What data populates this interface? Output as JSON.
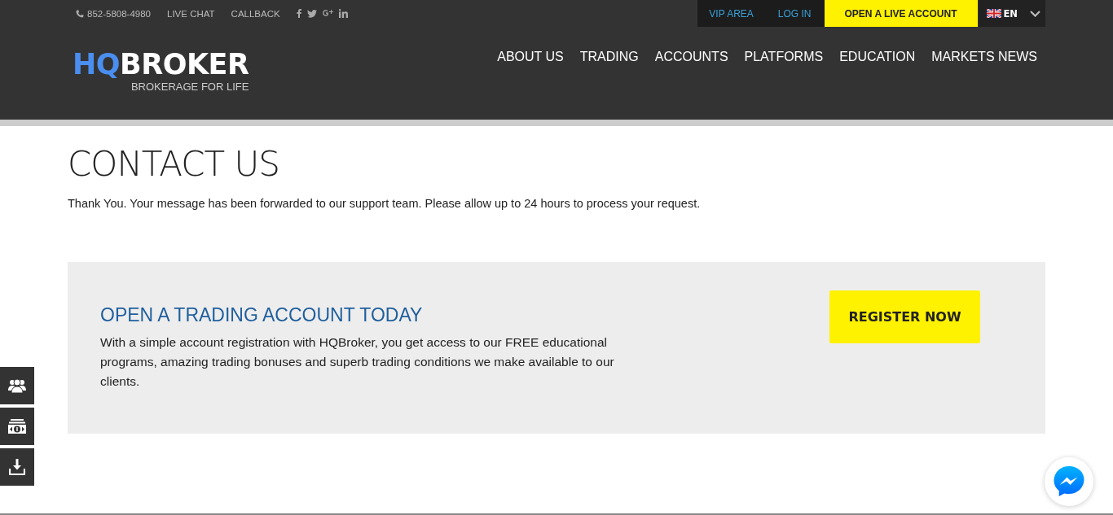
{
  "topbar": {
    "phone": "852-5808-4980",
    "links": [
      "LIVE CHAT",
      "CALLBACK"
    ],
    "social": [
      {
        "kind": "facebook"
      },
      {
        "kind": "twitter"
      },
      {
        "kind": "google-plus"
      },
      {
        "kind": "linkedin"
      }
    ],
    "account_links": [
      "VIP AREA",
      "LOG IN"
    ],
    "cta": "OPEN A LIVE ACCOUNT",
    "language": "EN"
  },
  "logo": {
    "accent": "HQ",
    "rest": "BROKER",
    "tagline": "BROKERAGE FOR LIFE"
  },
  "nav": [
    "ABOUT US",
    "TRADING",
    "ACCOUNTS",
    "PLATFORMS",
    "EDUCATION",
    "MARKETS NEWS"
  ],
  "page": {
    "title": "CONTACT US",
    "message": "Thank You. Your message has been forwarded to our support team. Please allow up to 24 hours to process your request."
  },
  "promo": {
    "title": "OPEN A TRADING ACCOUNT TODAY",
    "text": "With a simple account registration with HQBroker, you get access to our FREE educational programs, amazing trading bonuses and superb trading conditions we make available to our clients.",
    "button": "REGISTER NOW"
  },
  "side_tools": [
    {
      "kind": "people"
    },
    {
      "kind": "money"
    },
    {
      "kind": "download"
    }
  ]
}
